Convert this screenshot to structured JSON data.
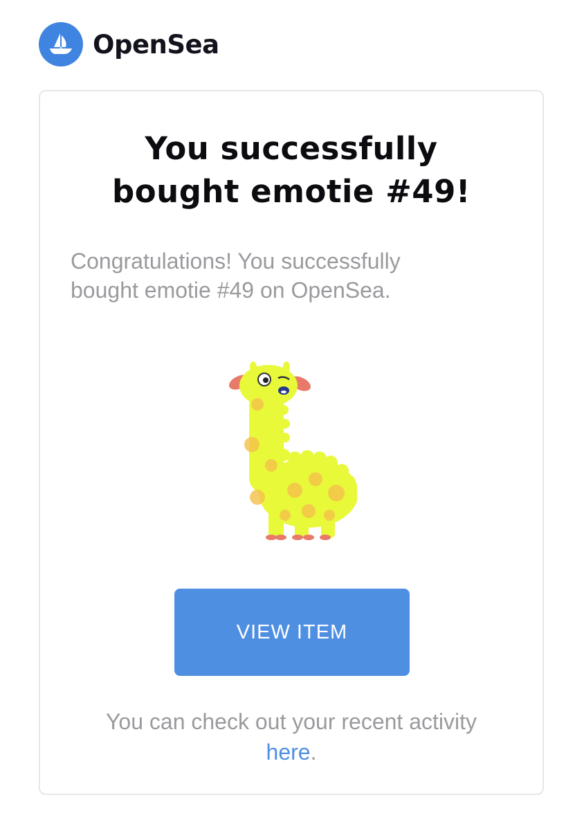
{
  "header": {
    "logo_icon": "opensea-ship-icon",
    "brand_name": "OpenSea"
  },
  "card": {
    "title_line1": "You successfully",
    "title_line2": "bought emotie #49!",
    "subtitle_line1": "Congratulations! You successfully",
    "subtitle_line2": "bought emotie #49 on OpenSea.",
    "image_icon": "llama-nft-image",
    "button_label": "VIEW ITEM",
    "footer_line1": "You can check out your recent activity",
    "footer_link": "here",
    "footer_end": "."
  },
  "colors": {
    "brand_blue": "#3f84e0",
    "button_blue": "#4f8fe2",
    "title_text": "#0c0c10",
    "muted_text": "#9a9a9e",
    "llama_body": "#e8f93a"
  }
}
